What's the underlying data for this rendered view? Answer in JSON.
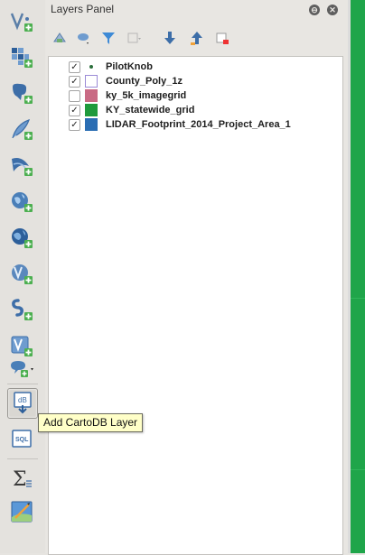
{
  "panel": {
    "title": "Layers Panel",
    "float_glyph": "⊖",
    "close_glyph": "✕"
  },
  "tooltip": {
    "text": "Add CartoDB Layer"
  },
  "toolbar_buttons": [
    {
      "name": "add-vector-layer-icon"
    },
    {
      "name": "add-raster-layer-icon"
    },
    {
      "name": "add-postgis-layer-icon"
    },
    {
      "name": "add-spatialite-layer-icon"
    },
    {
      "name": "add-mssql-layer-icon"
    },
    {
      "name": "add-wms-layer-icon"
    },
    {
      "name": "add-wcs-layer-icon"
    },
    {
      "name": "add-wfs-layer-icon"
    },
    {
      "name": "add-delimited-text-layer-icon"
    },
    {
      "name": "add-virtual-layer-icon"
    },
    {
      "name": "new-layer-dropdown-icon"
    },
    {
      "name": "add-cartodb-layer-icon"
    },
    {
      "name": "cartodb-sql-icon"
    },
    {
      "name": "sum-statistics-icon"
    },
    {
      "name": "georeferencer-icon"
    }
  ],
  "layers": [
    {
      "name": "PilotKnob",
      "checked": true,
      "symbol": "point",
      "color": "#2a6e3a"
    },
    {
      "name": "County_Poly_1z",
      "checked": true,
      "symbol": "outline",
      "color": "#9b8bd6"
    },
    {
      "name": "ky_5k_imagegrid",
      "checked": false,
      "symbol": "fill",
      "color": "#c96a84"
    },
    {
      "name": "KY_statewide_grid",
      "checked": true,
      "symbol": "fill",
      "color": "#1f9a3c"
    },
    {
      "name": "LIDAR_Footprint_2014_Project_Area_1",
      "checked": true,
      "symbol": "fill",
      "color": "#2a6db3"
    }
  ],
  "colors": {
    "map_canvas": "#1fa54a",
    "tooltip_bg": "#ffffc8"
  }
}
